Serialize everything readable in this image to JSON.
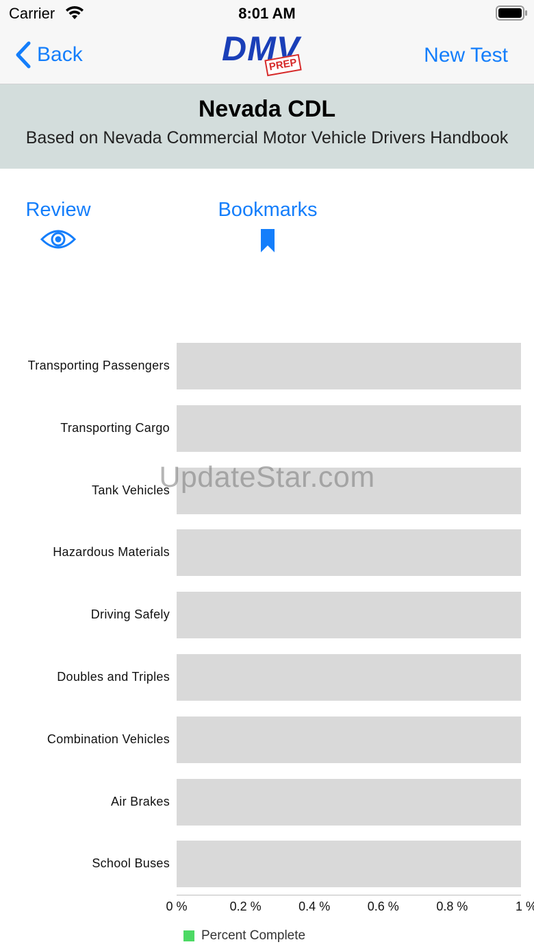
{
  "status_bar": {
    "carrier": "Carrier",
    "time": "8:01 AM"
  },
  "nav": {
    "back_label": "Back",
    "logo_main": "DMV",
    "logo_badge": "PREP",
    "new_test_label": "New Test"
  },
  "header": {
    "title": "Nevada CDL",
    "subtitle": "Based on Nevada Commercial Motor Vehicle Drivers Handbook"
  },
  "actions": {
    "review_label": "Review",
    "bookmarks_label": "Bookmarks"
  },
  "colors": {
    "accent": "#147efb",
    "header_bg": "#d3dddc",
    "bar_bg": "#d9d9d9",
    "complete": "#4cd964"
  },
  "chart_data": {
    "type": "bar",
    "orientation": "horizontal",
    "categories": [
      "Transporting Passengers",
      "Transporting Cargo",
      "Tank Vehicles",
      "Hazardous Materials",
      "Driving Safely",
      "Doubles and Triples",
      "Combination Vehicles",
      "Air Brakes",
      "School Buses"
    ],
    "series": [
      {
        "name": "Percent Complete",
        "values": [
          0,
          0,
          0,
          0,
          0,
          0,
          0,
          0,
          0
        ]
      }
    ],
    "xlim": [
      0,
      1
    ],
    "x_ticks": [
      "0 %",
      "0.2 %",
      "0.4 %",
      "0.6 %",
      "0.8 %",
      "1 %"
    ],
    "legend": "bottom-left",
    "grid": false
  },
  "watermark": "UpdateStar.com"
}
